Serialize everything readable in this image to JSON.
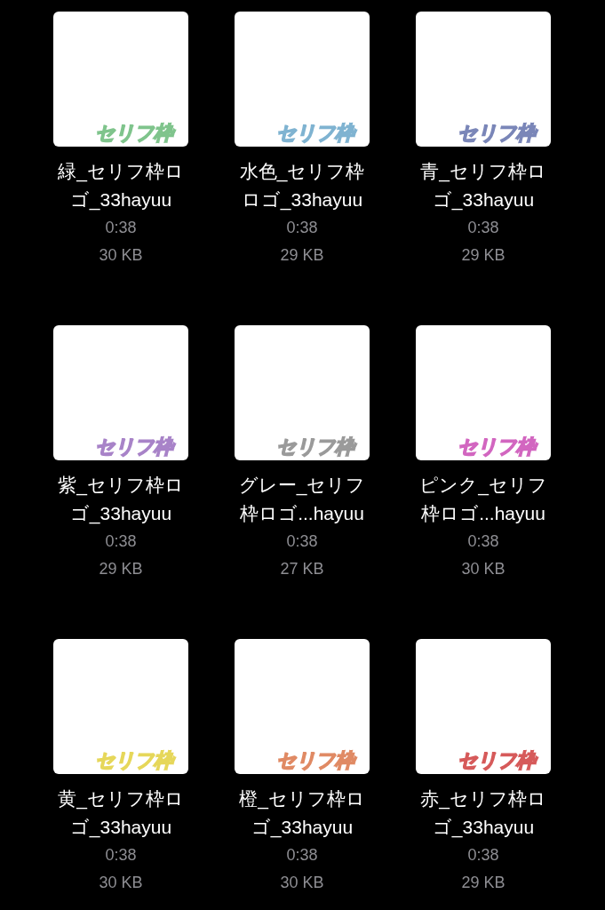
{
  "files": [
    {
      "name": "緑_セリフ枠ロゴ_33hayuu",
      "duration": "0:38",
      "size": "30 KB",
      "logo": "セリフ枠",
      "color": "#7fc48c"
    },
    {
      "name": "水色_セリフ枠ロゴ_33hayuu",
      "duration": "0:38",
      "size": "29 KB",
      "logo": "セリフ枠",
      "color": "#7fb3d1"
    },
    {
      "name": "青_セリフ枠ロゴ_33hayuu",
      "duration": "0:38",
      "size": "29 KB",
      "logo": "セリフ枠",
      "color": "#7a86b8"
    },
    {
      "name": "紫_セリフ枠ロゴ_33hayuu",
      "duration": "0:38",
      "size": "29 KB",
      "logo": "セリフ枠",
      "color": "#a883c8"
    },
    {
      "name": "グレー_セリフ枠ロゴ...hayuu",
      "duration": "0:38",
      "size": "27 KB",
      "logo": "セリフ枠",
      "color": "#9a9a9a"
    },
    {
      "name": "ピンク_セリフ枠ロゴ...hayuu",
      "duration": "0:38",
      "size": "30 KB",
      "logo": "セリフ枠",
      "color": "#d266c0"
    },
    {
      "name": "黄_セリフ枠ロゴ_33hayuu",
      "duration": "0:38",
      "size": "30 KB",
      "logo": "セリフ枠",
      "color": "#e6d75a"
    },
    {
      "name": "橙_セリフ枠ロゴ_33hayuu",
      "duration": "0:38",
      "size": "30 KB",
      "logo": "セリフ枠",
      "color": "#e08a64"
    },
    {
      "name": "赤_セリフ枠ロゴ_33hayuu",
      "duration": "0:38",
      "size": "29 KB",
      "logo": "セリフ枠",
      "color": "#d65a5a"
    }
  ]
}
